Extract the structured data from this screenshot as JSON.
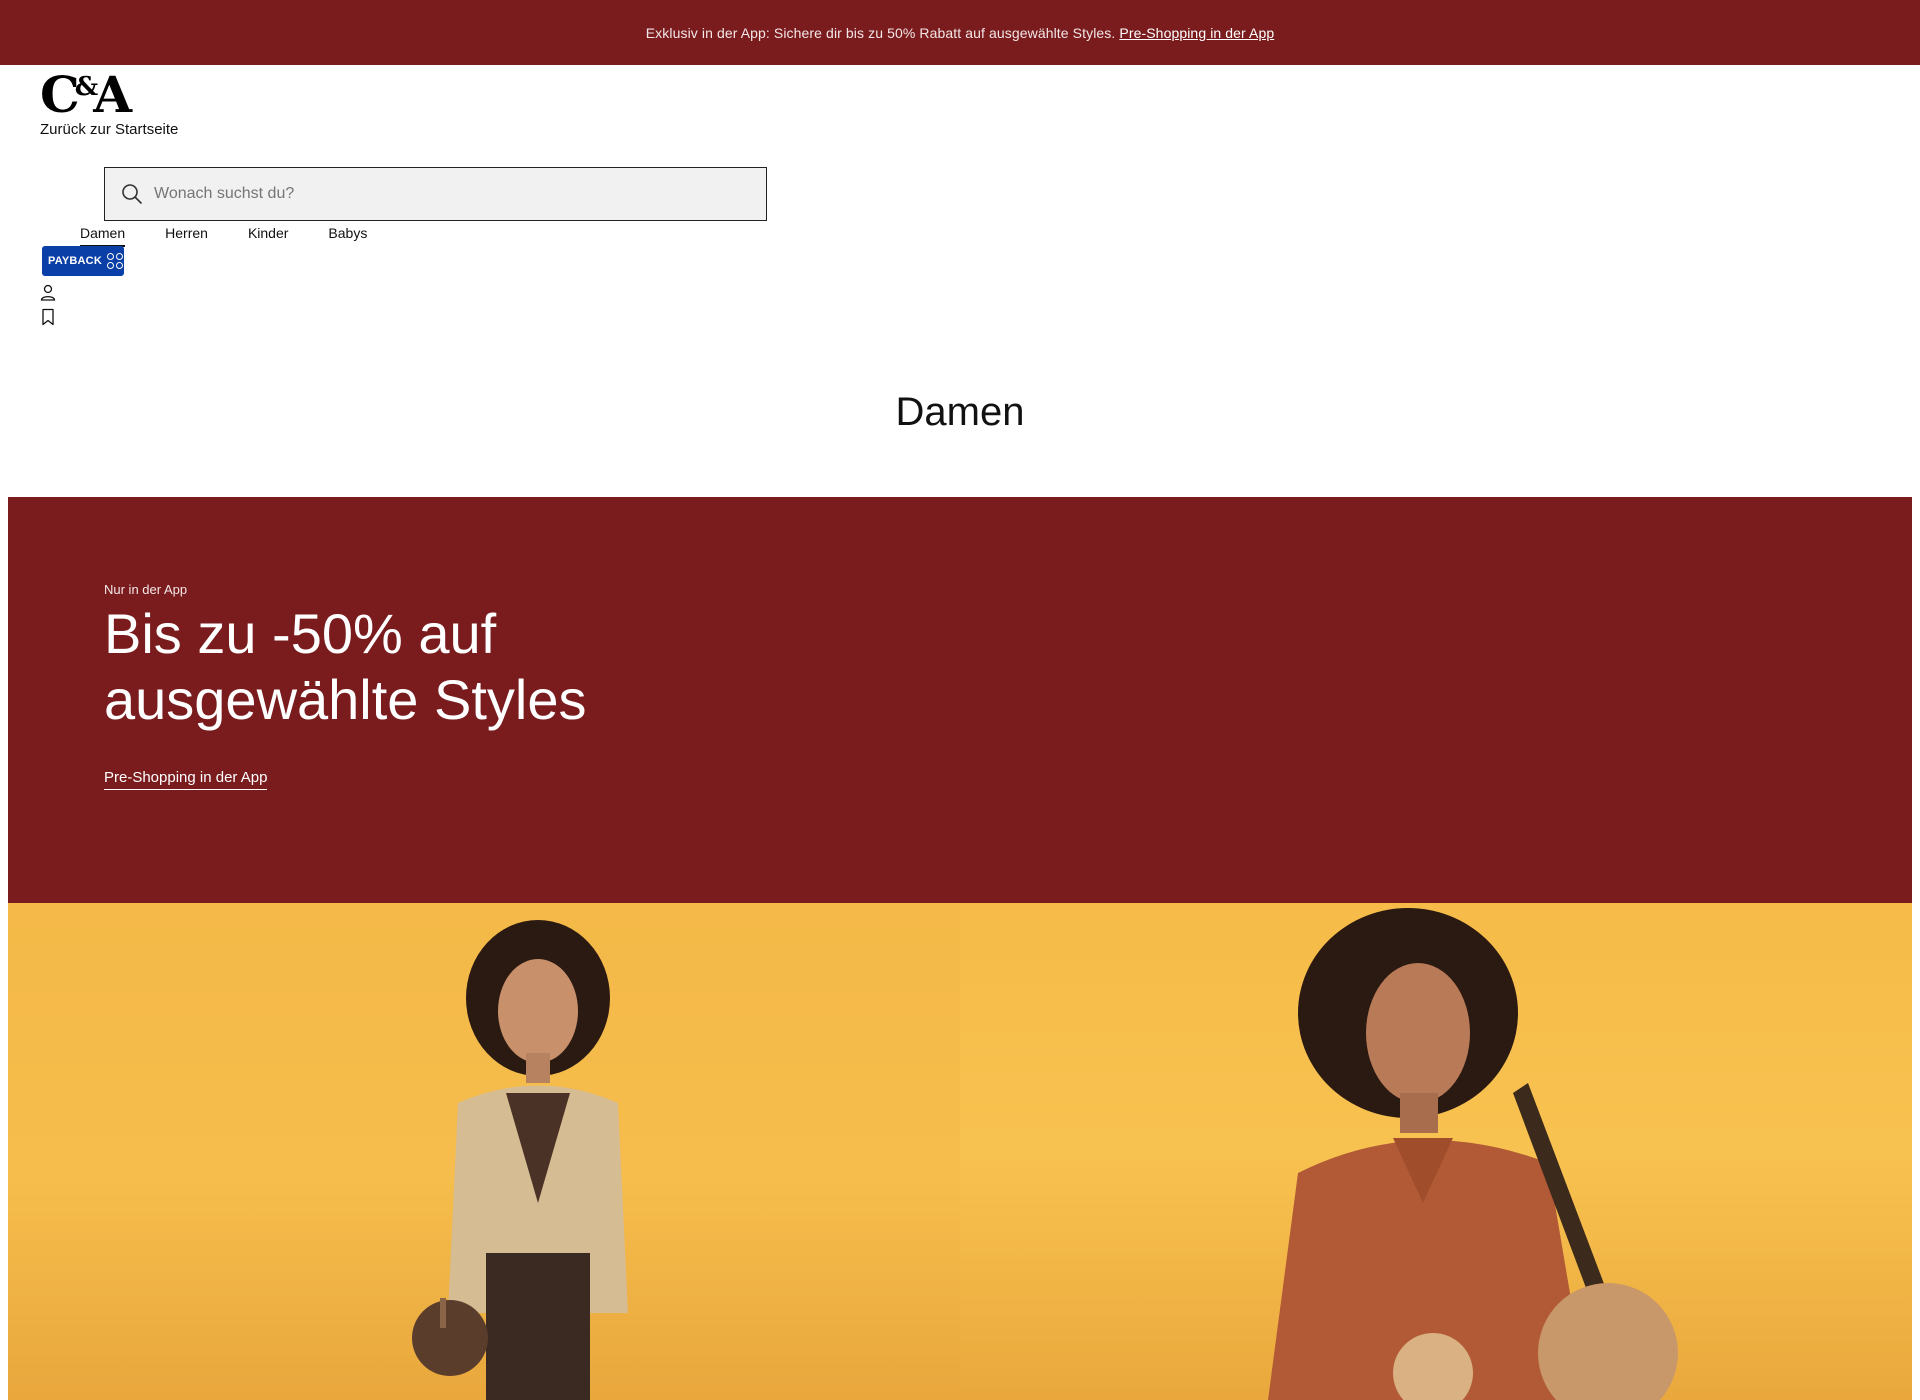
{
  "promo_bar": {
    "text": "Exklusiv in der App: Sichere dir bis zu 50% Rabatt auf ausgewählte Styles.",
    "link": "Pre-Shopping in der App",
    "background": "#7a1c1e"
  },
  "header": {
    "logo_main": "C",
    "logo_amp": "&",
    "logo_end": "A",
    "back_home": "Zurück zur Startseite",
    "search_placeholder": "Wonach suchst du?",
    "nav": [
      "Damen",
      "Herren",
      "Kinder",
      "Babys"
    ],
    "active_nav": "Damen",
    "payback_label": "PAYBACK",
    "icons": [
      "search-icon",
      "user-icon",
      "bookmark-icon"
    ]
  },
  "page": {
    "title": "Damen"
  },
  "hero": {
    "eyebrow": "Nur in der App",
    "headline": "Bis zu -50% auf ausgewählte Styles",
    "cta": "Pre-Shopping in der App",
    "background": "#7a1c1e"
  },
  "image_section": {
    "background": "#f4b948"
  }
}
